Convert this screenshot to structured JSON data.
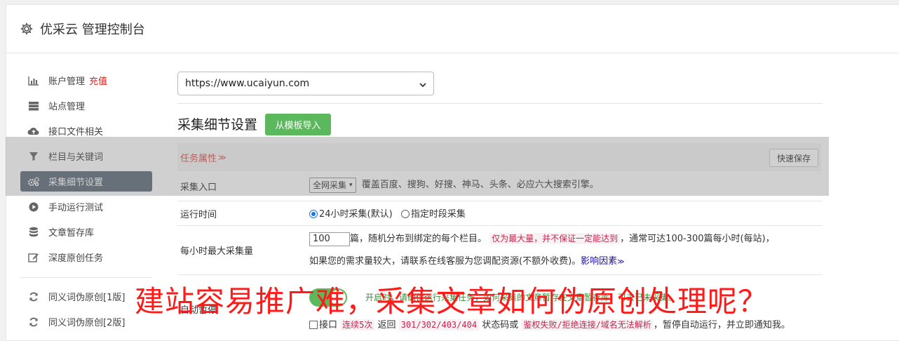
{
  "header": {
    "title": "优采云 管理控制台",
    "icon": "gear-icon"
  },
  "sidebar": {
    "items": [
      {
        "label": "账户管理",
        "extra": "充值",
        "icon": "bar-chart-icon"
      },
      {
        "label": "站点管理",
        "icon": "server-icon"
      },
      {
        "label": "接口文件相关",
        "icon": "cloud-upload-icon"
      },
      {
        "label": "栏目与关键词",
        "icon": "filter-icon"
      },
      {
        "label": "采集细节设置",
        "icon": "gears-icon",
        "active": true
      },
      {
        "label": "手动运行测试",
        "icon": "play-circle-icon"
      },
      {
        "label": "文章暂存库",
        "icon": "database-icon"
      },
      {
        "label": "深度原创任务",
        "icon": "edit-icon"
      },
      {
        "label": "同义词伪原创[1版]",
        "icon": "refresh-icon"
      },
      {
        "label": "同义词伪原创[2版]",
        "icon": "refresh-icon"
      }
    ]
  },
  "site_select": {
    "value": "https://www.ucaiyun.com"
  },
  "section": {
    "title": "采集细节设置",
    "import_button": "从模板导入"
  },
  "task": {
    "label": "任务属性",
    "label_icon": "double-chevron-down-icon",
    "quick_save": "快速保存"
  },
  "rows": {
    "entry": {
      "label": "采集入口",
      "select": "全网采集",
      "desc": "覆盖百度、搜狗、好搜、神马、头条、必应六大搜索引擎。"
    },
    "runtime": {
      "label": "运行时间",
      "option1": "24小时采集(默认)",
      "option2": "指定时段采集"
    },
    "max": {
      "label": "每小时最大采集量",
      "value": "100",
      "text1": "篇，随机分布到绑定的每个栏目。",
      "note": "仅为最大量，并不保证一定能达到",
      "text2": "，通常可达100-300篇每小时(每站)，",
      "text3": "如果您的需求量较大，请联系在线客服为您调配资源(不额外收费)。",
      "link": "影响因素"
    },
    "auto": {
      "label": "自动暂停",
      "toggle_text": "开启时，请确保运行采集任务，如何采集的文章暂存在文章暂存库，可去已未采集。",
      "check_label": "接口",
      "code1": "连续5次",
      "text_a": "返回",
      "code2": "301/302/403/404",
      "text_b": "状态码或",
      "code3": "鉴权失败/拒绝连接/域名无法解析",
      "text_c": "，暂停自动运行，并立即通知我。"
    }
  },
  "caption": "建站容易推广难，采集文章如何伪原创处理呢？"
}
